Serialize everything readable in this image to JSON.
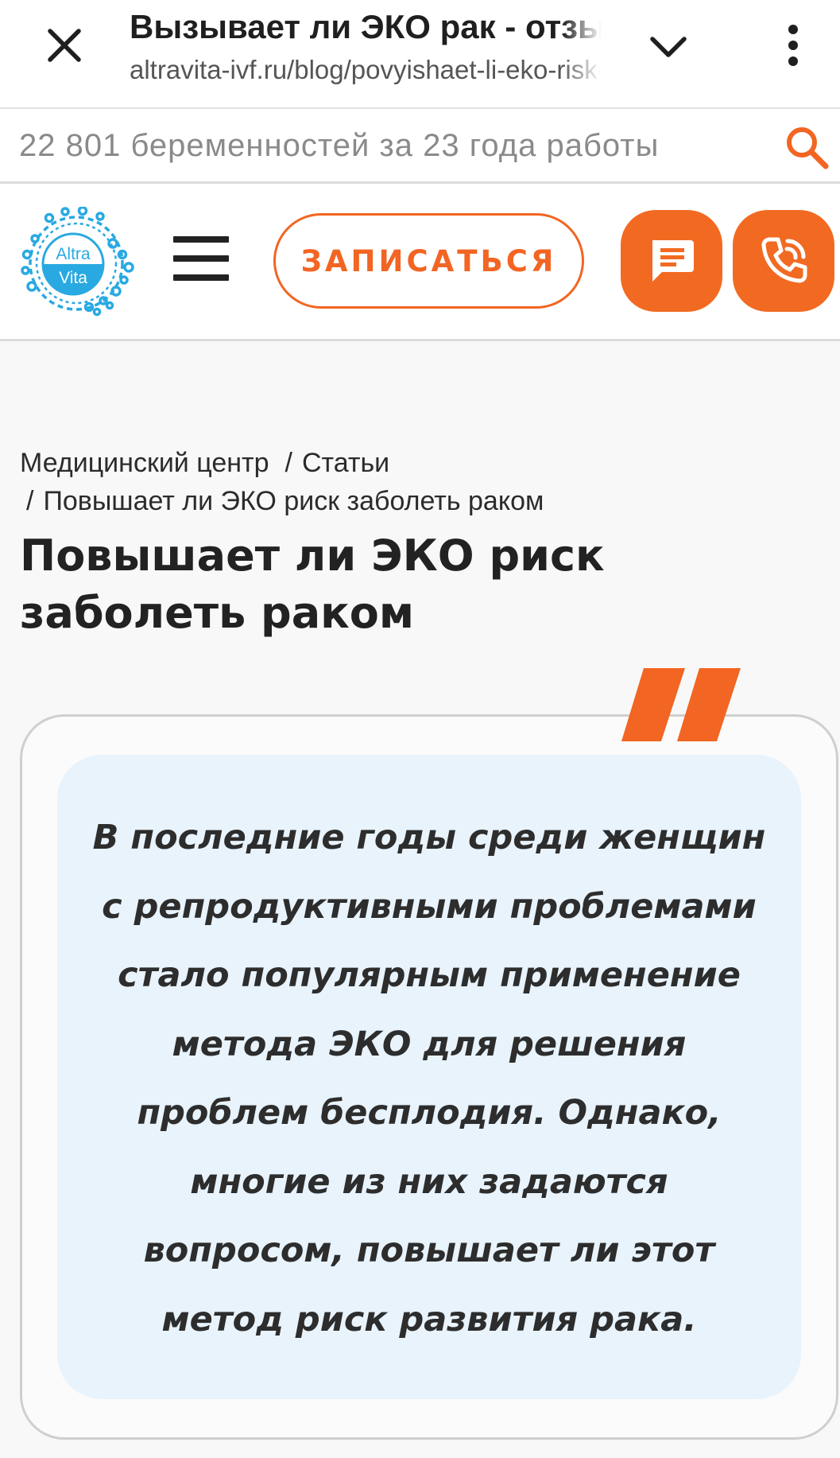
{
  "browser": {
    "tab_title": "Вызывает ли ЭКО рак - отзывы",
    "url": "altravita-ivf.ru/blog/povyishaet-li-eko-risk-zabolet-rakom"
  },
  "search": {
    "placeholder": "22 801 беременностей за 23 года работы"
  },
  "header": {
    "logo_text_1": "Altra",
    "logo_text_2": "Vita",
    "signup_label": "ЗАПИСАТЬСЯ",
    "accent_color": "#f26522",
    "logo_color": "#29a9e1"
  },
  "breadcrumb": {
    "items": [
      "Медицинский центр",
      "Статьи",
      "Повышает ли ЭКО риск заболеть раком"
    ],
    "separator": "/"
  },
  "article": {
    "title": "Повышает ли ЭКО риск заболеть раком",
    "quote": "В последние годы среди женщин с репродуктивными проблемами стало популярным применение метода ЭКО для решения проблем бесплодия. Однако, многие из них задаются вопросом, повышает ли этот метод риск развития рака."
  },
  "icons": {
    "close": "close-icon",
    "expand": "chevron-down-icon",
    "more": "more-vert-icon",
    "search": "search-icon",
    "menu": "hamburger-icon",
    "chat": "chat-icon",
    "call": "phone-call-icon",
    "quote": "quote-mark-icon"
  }
}
